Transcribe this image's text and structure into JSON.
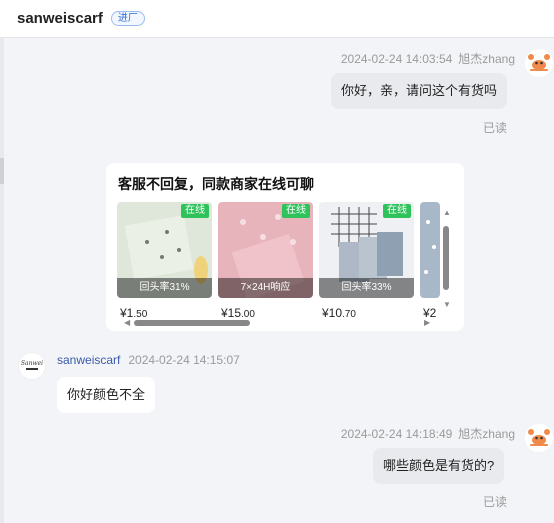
{
  "header": {
    "shop_name": "sanweiscarf",
    "badge": "进厂"
  },
  "messages": [
    {
      "time": "2024-02-24 14:03:54",
      "sender": "旭杰zhang",
      "text": "你好，亲，请问这个有货吗",
      "status": "已读"
    },
    {
      "time": "2024-02-24 14:15:07",
      "sender": "sanweiscarf",
      "text": "你好颜色不全"
    },
    {
      "time": "2024-02-24 14:18:49",
      "sender": "旭杰zhang",
      "text": "哪些颜色是有货的?",
      "status": "已读"
    }
  ],
  "recommend_card": {
    "title": "客服不回复，同款商家在线可聊",
    "products": [
      {
        "tag": "在线",
        "label": "回头率31%",
        "price_int": "¥1",
        "price_dec": ".50"
      },
      {
        "tag": "在线",
        "label": "7×24H响应",
        "price_int": "¥15",
        "price_dec": ".00"
      },
      {
        "tag": "在线",
        "label": "回头率33%",
        "price_int": "¥10",
        "price_dec": ".70"
      },
      {
        "tag": "",
        "label": "",
        "price_int": "¥2",
        "price_dec": ""
      }
    ]
  },
  "icons": {
    "user_avatar": "crab-avatar-icon",
    "shop_avatar": "shop-logo-icon",
    "scroll_up": "triangle-up-icon",
    "scroll_down": "triangle-down-icon",
    "scroll_left": "triangle-left-icon",
    "scroll_right": "triangle-right-icon"
  },
  "colors": {
    "online_tag": "#2fc25b",
    "badge_blue": "#2f6fd6",
    "bubble_grey": "#e9eaee"
  }
}
